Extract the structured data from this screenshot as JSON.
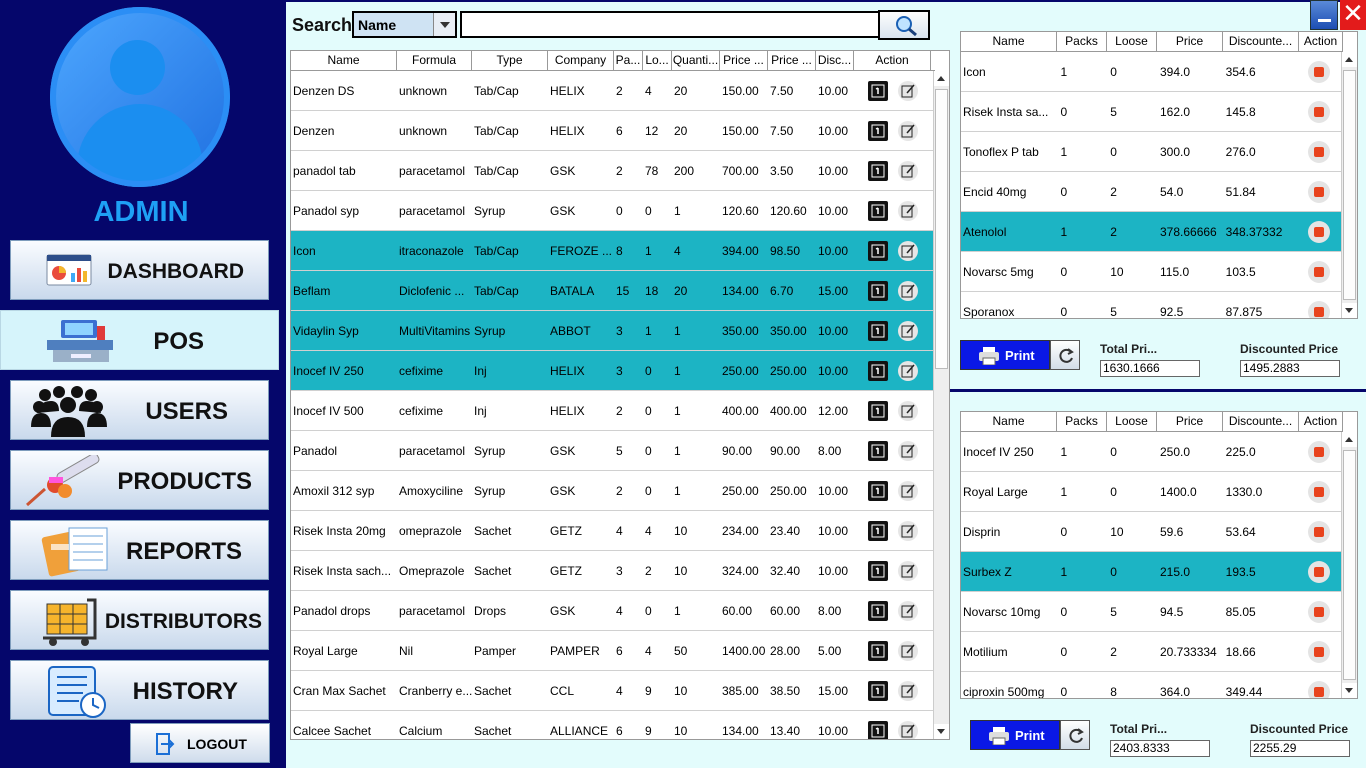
{
  "sidebar": {
    "user": "ADMIN",
    "nav": [
      {
        "label": "DASHBOARD",
        "icon": "dashboard-icon"
      },
      {
        "label": "POS",
        "icon": "pos-register-icon"
      },
      {
        "label": "USERS",
        "icon": "users-group-icon"
      },
      {
        "label": "PRODUCTS",
        "icon": "medicine-icon"
      },
      {
        "label": "REPORTS",
        "icon": "reports-icon"
      },
      {
        "label": "DISTRIBUTORS",
        "icon": "distributor-cart-icon"
      },
      {
        "label": "HISTORY",
        "icon": "history-icon"
      }
    ],
    "logout": "LOGOUT",
    "active": "POS"
  },
  "search": {
    "label": "Search",
    "type_value": "Name",
    "query": ""
  },
  "products": {
    "columns": [
      "Name",
      "Formula",
      "Type",
      "Company",
      "Pa...",
      "Lo...",
      "Quanti...",
      "Price ...",
      "Price ...",
      "Disc...",
      "Action"
    ],
    "rows": [
      {
        "name": "Denzen DS",
        "formula": "unknown",
        "type": "Tab/Cap",
        "company": "HELIX",
        "pa": "2",
        "lo": "4",
        "qty": "20",
        "price1": "150.00",
        "price2": "7.50",
        "disc": "10.00",
        "selected": false
      },
      {
        "name": "Denzen",
        "formula": "unknown",
        "type": "Tab/Cap",
        "company": "HELIX",
        "pa": "6",
        "lo": "12",
        "qty": "20",
        "price1": "150.00",
        "price2": "7.50",
        "disc": "10.00",
        "selected": false
      },
      {
        "name": "panadol tab",
        "formula": "paracetamol",
        "type": "Tab/Cap",
        "company": "GSK",
        "pa": "2",
        "lo": "78",
        "qty": "200",
        "price1": "700.00",
        "price2": "3.50",
        "disc": "10.00",
        "selected": false
      },
      {
        "name": "Panadol syp",
        "formula": "paracetamol",
        "type": "Syrup",
        "company": "GSK",
        "pa": "0",
        "lo": "0",
        "qty": "1",
        "price1": "120.60",
        "price2": "120.60",
        "disc": "10.00",
        "selected": false
      },
      {
        "name": "Icon",
        "formula": "itraconazole",
        "type": "Tab/Cap",
        "company": "FEROZE ...",
        "pa": "8",
        "lo": "1",
        "qty": "4",
        "price1": "394.00",
        "price2": "98.50",
        "disc": "10.00",
        "selected": true
      },
      {
        "name": "Beflam",
        "formula": "Diclofenic ...",
        "type": "Tab/Cap",
        "company": "BATALA",
        "pa": "15",
        "lo": "18",
        "qty": "20",
        "price1": "134.00",
        "price2": "6.70",
        "disc": "15.00",
        "selected": true
      },
      {
        "name": "Vidaylin Syp",
        "formula": "MultiVitamins",
        "type": "Syrup",
        "company": "ABBOT",
        "pa": "3",
        "lo": "1",
        "qty": "1",
        "price1": "350.00",
        "price2": "350.00",
        "disc": "10.00",
        "selected": true
      },
      {
        "name": "Inocef IV 250",
        "formula": "cefixime",
        "type": "Inj",
        "company": "HELIX",
        "pa": "3",
        "lo": "0",
        "qty": "1",
        "price1": "250.00",
        "price2": "250.00",
        "disc": "10.00",
        "selected": true
      },
      {
        "name": "Inocef IV 500",
        "formula": "cefixime",
        "type": "Inj",
        "company": "HELIX",
        "pa": "2",
        "lo": "0",
        "qty": "1",
        "price1": "400.00",
        "price2": "400.00",
        "disc": "12.00",
        "selected": false
      },
      {
        "name": "Panadol",
        "formula": "paracetamol",
        "type": "Syrup",
        "company": "GSK",
        "pa": "5",
        "lo": "0",
        "qty": "1",
        "price1": "90.00",
        "price2": "90.00",
        "disc": "8.00",
        "selected": false
      },
      {
        "name": "Amoxil 312 syp",
        "formula": "Amoxyciline",
        "type": "Syrup",
        "company": "GSK",
        "pa": "2",
        "lo": "0",
        "qty": "1",
        "price1": "250.00",
        "price2": "250.00",
        "disc": "10.00",
        "selected": false
      },
      {
        "name": "Risek Insta 20mg",
        "formula": "omeprazole",
        "type": "Sachet",
        "company": "GETZ",
        "pa": "4",
        "lo": "4",
        "qty": "10",
        "price1": "234.00",
        "price2": "23.40",
        "disc": "10.00",
        "selected": false
      },
      {
        "name": "Risek Insta sach...",
        "formula": "Omeprazole",
        "type": "Sachet",
        "company": "GETZ",
        "pa": "3",
        "lo": "2",
        "qty": "10",
        "price1": "324.00",
        "price2": "32.40",
        "disc": "10.00",
        "selected": false
      },
      {
        "name": "Panadol drops",
        "formula": "paracetamol",
        "type": "Drops",
        "company": "GSK",
        "pa": "4",
        "lo": "0",
        "qty": "1",
        "price1": "60.00",
        "price2": "60.00",
        "disc": "8.00",
        "selected": false
      },
      {
        "name": "Royal Large",
        "formula": "Nil",
        "type": "Pamper",
        "company": "PAMPER",
        "pa": "6",
        "lo": "4",
        "qty": "50",
        "price1": "1400.00",
        "price2": "28.00",
        "disc": "5.00",
        "selected": false
      },
      {
        "name": "Cran Max Sachet",
        "formula": "Cranberry e...",
        "type": "Sachet",
        "company": "CCL",
        "pa": "4",
        "lo": "9",
        "qty": "10",
        "price1": "385.00",
        "price2": "38.50",
        "disc": "15.00",
        "selected": false
      },
      {
        "name": "Calcee Sachet",
        "formula": "Calcium",
        "type": "Sachet",
        "company": "ALLIANCE",
        "pa": "6",
        "lo": "9",
        "qty": "10",
        "price1": "134.00",
        "price2": "13.40",
        "disc": "10.00",
        "selected": false
      }
    ]
  },
  "cart1": {
    "columns": [
      "Name",
      "Packs",
      "Loose",
      "Price",
      "Discounte...",
      "Action"
    ],
    "rows": [
      {
        "name": "Icon",
        "packs": "1",
        "loose": "0",
        "price": "394.0",
        "disc": "354.6",
        "selected": false
      },
      {
        "name": "Risek Insta sa...",
        "packs": "0",
        "loose": "5",
        "price": "162.0",
        "disc": "145.8",
        "selected": false
      },
      {
        "name": "Tonoflex P tab",
        "packs": "1",
        "loose": "0",
        "price": "300.0",
        "disc": "276.0",
        "selected": false
      },
      {
        "name": "Encid 40mg",
        "packs": "0",
        "loose": "2",
        "price": "54.0",
        "disc": "51.84",
        "selected": false
      },
      {
        "name": "Atenolol",
        "packs": "1",
        "loose": "2",
        "price": "378.66666",
        "disc": "348.37332",
        "selected": true
      },
      {
        "name": "Novarsc 5mg",
        "packs": "0",
        "loose": "10",
        "price": "115.0",
        "disc": "103.5",
        "selected": false
      },
      {
        "name": "Sporanox",
        "packs": "0",
        "loose": "5",
        "price": "92.5",
        "disc": "87.875",
        "selected": false
      }
    ],
    "print": "Print",
    "total_label": "Total Pri...",
    "total": "1630.1666",
    "discounted_label": "Discounted Price",
    "discounted": "1495.2883"
  },
  "cart2": {
    "columns": [
      "Name",
      "Packs",
      "Loose",
      "Price",
      "Discounte...",
      "Action"
    ],
    "rows": [
      {
        "name": "Inocef IV 250",
        "packs": "1",
        "loose": "0",
        "price": "250.0",
        "disc": "225.0",
        "selected": false
      },
      {
        "name": "Royal Large",
        "packs": "1",
        "loose": "0",
        "price": "1400.0",
        "disc": "1330.0",
        "selected": false
      },
      {
        "name": "Disprin",
        "packs": "0",
        "loose": "10",
        "price": "59.6",
        "disc": "53.64",
        "selected": false
      },
      {
        "name": "Surbex Z",
        "packs": "1",
        "loose": "0",
        "price": "215.0",
        "disc": "193.5",
        "selected": true
      },
      {
        "name": "Novarsc 10mg",
        "packs": "0",
        "loose": "5",
        "price": "94.5",
        "disc": "85.05",
        "selected": false
      },
      {
        "name": "Motilium",
        "packs": "0",
        "loose": "2",
        "price": "20.733334",
        "disc": "18.66",
        "selected": false
      },
      {
        "name": "ciproxin 500mg",
        "packs": "0",
        "loose": "8",
        "price": "364.0",
        "disc": "349.44",
        "selected": false
      }
    ],
    "print": "Print",
    "total_label": "Total Pri...",
    "total": "2403.8333",
    "discounted_label": "Discounted Price",
    "discounted": "2255.29"
  },
  "colors": {
    "sidebar_bg": "#05066b",
    "selected_row": "#1cb4c4",
    "main_bg": "#e3fcfc",
    "print_btn": "#0a18e6",
    "close": "#e31b1b",
    "admin": "#1ea0f5"
  }
}
